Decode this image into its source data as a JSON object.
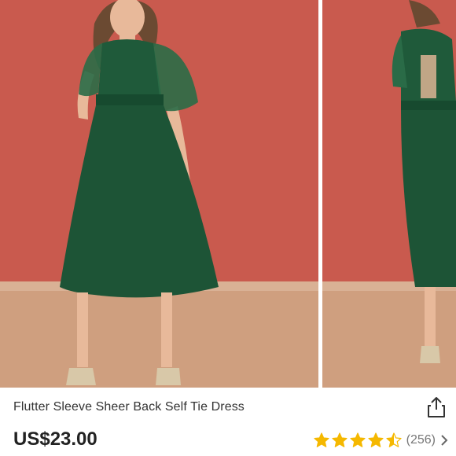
{
  "product": {
    "title": "Flutter Sleeve Sheer Back Self Tie Dress",
    "price": "US$23.00",
    "rating_value": 4.5,
    "rating_max": 5,
    "review_count": "(256)"
  },
  "colors": {
    "wall": "#c95a4e",
    "floor": "#cf9f7f",
    "dress": "#1d5436",
    "star": "#f5b800"
  },
  "icons": {
    "share": "share-icon",
    "star": "star-icon",
    "chevron": "chevron-right-icon"
  }
}
